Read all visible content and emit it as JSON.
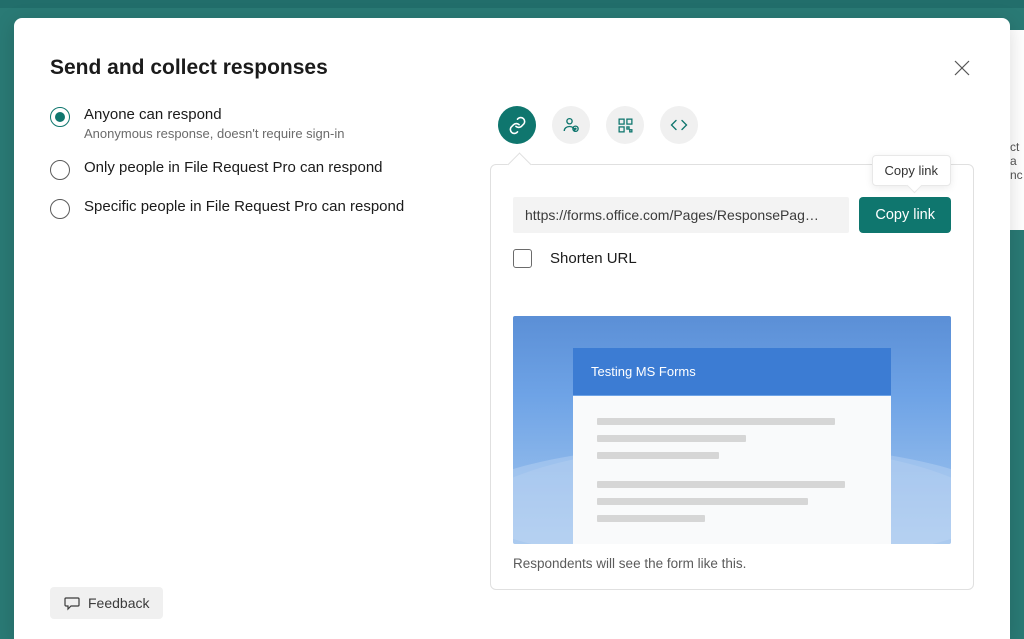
{
  "modal": {
    "title": "Send and collect responses",
    "close_label": "Close"
  },
  "audience_options": [
    {
      "title": "Anyone can respond",
      "desc": "Anonymous response, doesn't require sign-in",
      "selected": true
    },
    {
      "title": "Only people in File Request Pro can respond",
      "desc": "",
      "selected": false
    },
    {
      "title": "Specific people in File Request Pro can respond",
      "desc": "",
      "selected": false
    }
  ],
  "feedback": {
    "label": "Feedback"
  },
  "share_tabs": {
    "link": "Link",
    "invite": "Invite",
    "qr": "QR Code",
    "embed": "Embed"
  },
  "link_panel": {
    "url": "https://forms.office.com/Pages/ResponsePag…",
    "copy_button": "Copy link",
    "tooltip": "Copy link",
    "shorten_label": "Shorten URL"
  },
  "preview": {
    "form_title": "Testing MS Forms",
    "caption": "Respondents will see the form like this."
  },
  "bg_text": "ct"
}
